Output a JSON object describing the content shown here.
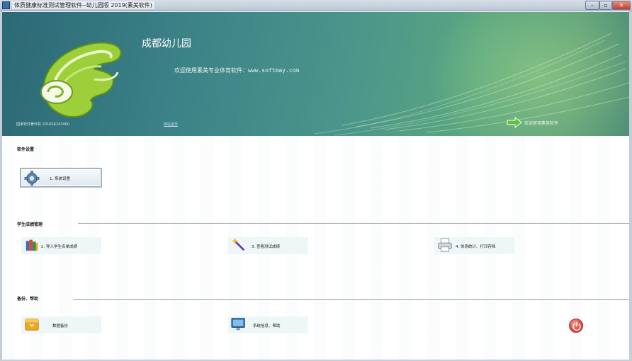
{
  "window": {
    "title": "体质健康标准测试管理软件--幼儿园版 2019(素美软件)",
    "min_label": "–",
    "max_label": "▫",
    "close_label": "✕"
  },
  "banner": {
    "school_name": "成都幼儿园",
    "welcome": "欢迎使用素美专业体育软件：www.softmay.com",
    "reg_no": "国家软件著作权 2016SR243460",
    "site_link": "网站首页",
    "enter_label": "欢迎使用素美软件"
  },
  "sections": {
    "settings": {
      "title": "软件设置"
    },
    "students": {
      "title": "学生成绩管理"
    },
    "backup": {
      "title": "备份、帮助"
    }
  },
  "buttons": {
    "system_settings": "1.  系统设置",
    "import_students": "2.  导入学生名单成绩",
    "view_scores": "3.  查看测试成绩",
    "stats_print": "4.  体测统计、打印存档",
    "data_backup": "数据备份",
    "sys_info_help": "系统信息、帮助"
  },
  "colors": {
    "banner_primary": "#3c8388",
    "tile_bg": "#eef6f8",
    "power_red": "#d8453f"
  },
  "icons": {
    "gear": "gear-icon",
    "books": "books-icon",
    "wand": "magic-wand-icon",
    "printer": "printer-icon",
    "backup": "backup-box-icon",
    "monitor": "monitor-icon",
    "power": "power-icon",
    "arrow": "green-arrow-icon"
  }
}
